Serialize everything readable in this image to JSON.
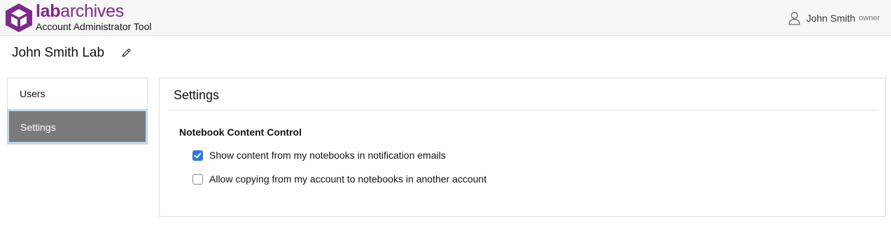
{
  "header": {
    "brand_bold": "lab",
    "brand_rest": "archives",
    "subtitle": "Account Administrator Tool",
    "user_name": "John Smith",
    "user_role": "owner",
    "icons": {
      "logo": "labarchives-cube-logo",
      "user": "user-icon"
    }
  },
  "lab": {
    "title": "John Smith Lab",
    "edit_icon": "pencil-icon"
  },
  "sidebar": {
    "items": [
      {
        "label": "Users",
        "active": false
      },
      {
        "label": "Settings",
        "active": true
      }
    ]
  },
  "settings": {
    "title": "Settings",
    "section_title": "Notebook Content Control",
    "options": [
      {
        "label": "Show content from my notebooks in notification emails",
        "checked": true
      },
      {
        "label": "Allow copying from my account to notebooks in another account",
        "checked": false
      }
    ]
  },
  "colors": {
    "brand": "#7d2a8c",
    "active_nav_bg": "#7a7a7a",
    "active_nav_border": "#bcd8ef",
    "checkbox_checked": "#2a7ae2"
  }
}
